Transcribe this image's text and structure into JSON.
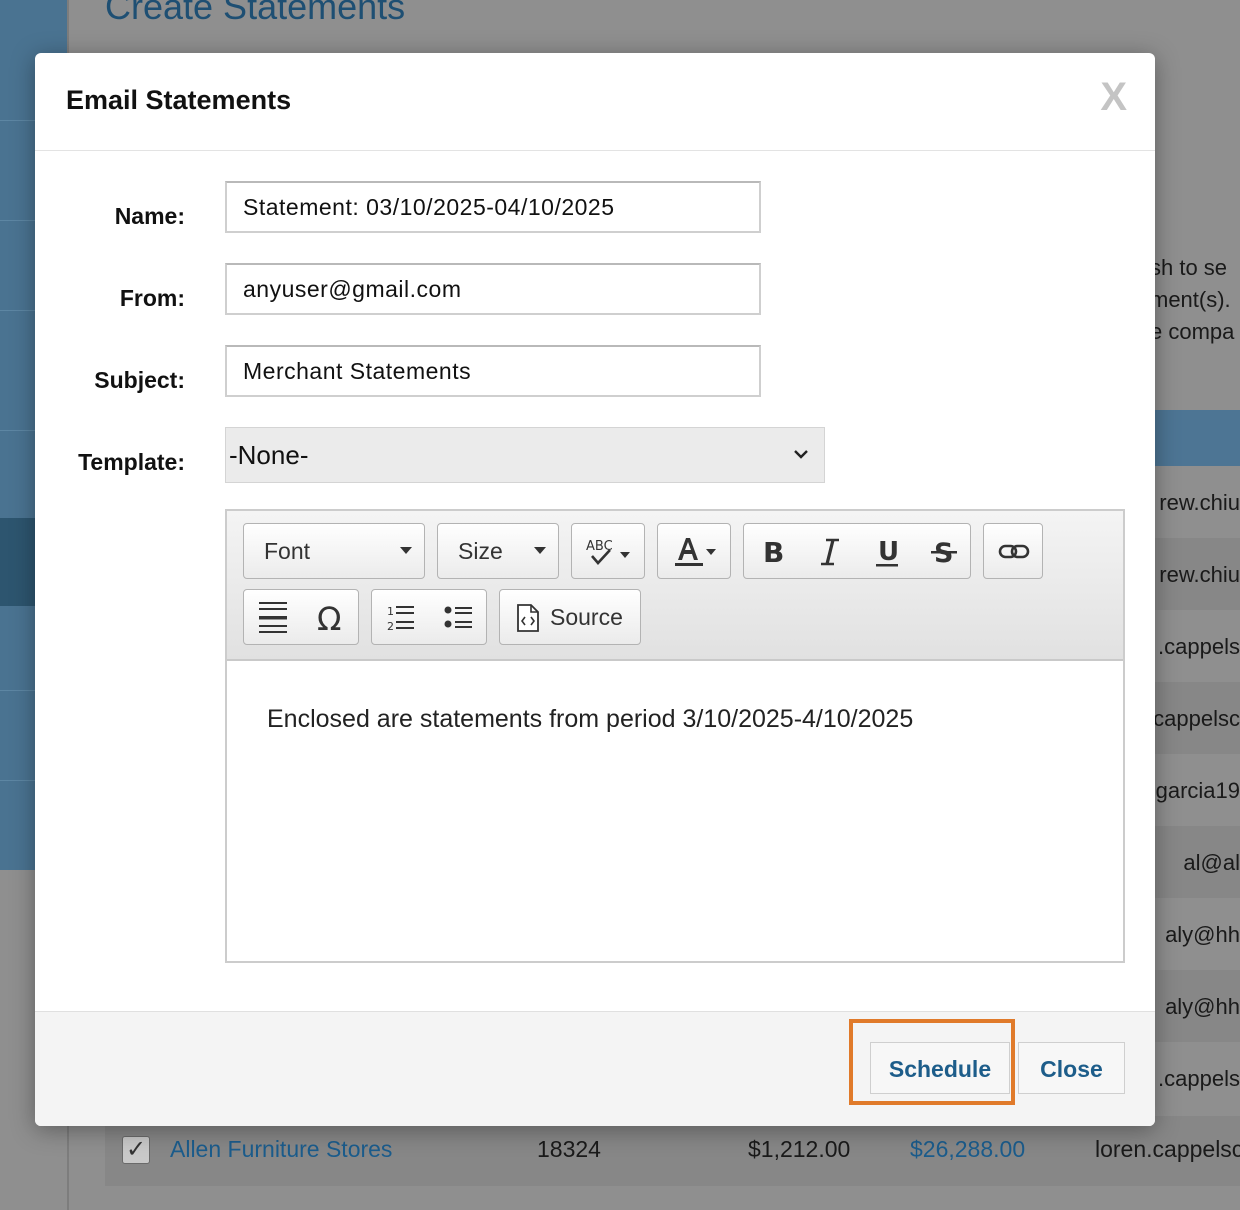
{
  "background": {
    "page_title": "Create Statements",
    "description_lines": [
      "sh to se",
      "ment(s).",
      "e compa"
    ],
    "row_emails": [
      "rew.chiu",
      "rew.chiu",
      ".cappels",
      "cappelsc",
      "garcia19",
      "al@al",
      "aly@hh",
      "aly@hh",
      ".cappels"
    ],
    "last_row": {
      "name": "Allen Furniture Stores",
      "id": "18324",
      "amount": "$1,212.00",
      "total": "$26,288.00",
      "email": "loren.cappelsc"
    }
  },
  "modal": {
    "title": "Email Statements",
    "close_glyph": "X",
    "fields": {
      "name_label": "Name:",
      "name_value": "Statement: 03/10/2025-04/10/2025",
      "from_label": "From:",
      "from_value": "anyuser@gmail.com",
      "subject_label": "Subject:",
      "subject_value": "Merchant Statements",
      "template_label": "Template:",
      "template_value": "-None-"
    },
    "toolbar": {
      "font_label": "Font",
      "size_label": "Size",
      "spell_icon_text": "ABC",
      "source_label": "Source"
    },
    "editor_body": "Enclosed are statements from period 3/10/2025-4/10/2025",
    "footer": {
      "schedule_label": "Schedule",
      "close_label": "Close"
    },
    "colors": {
      "accent": "#1d5d8a",
      "highlight": "#e07a2a"
    }
  }
}
